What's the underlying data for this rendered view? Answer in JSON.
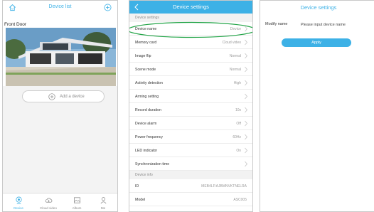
{
  "device_list": {
    "title": "Device list",
    "device": {
      "name": "Front Door"
    },
    "add_device_label": "Add a device",
    "tabs": [
      {
        "label": "Device",
        "icon": "camera-icon",
        "active": true
      },
      {
        "label": "Cloud video",
        "icon": "cloud-icon",
        "active": false
      },
      {
        "label": "Album",
        "icon": "album-icon",
        "active": false
      },
      {
        "label": "Me",
        "icon": "user-icon",
        "active": false
      }
    ]
  },
  "device_settings": {
    "title": "Device settings",
    "section_settings": "Device settings",
    "rows": [
      {
        "label": "Device name",
        "value": "Device"
      },
      {
        "label": "Memory card",
        "value": "Cloud video"
      },
      {
        "label": "Image flip",
        "value": "Normal"
      },
      {
        "label": "Scene mode",
        "value": "Normal"
      },
      {
        "label": "Activity detection",
        "value": "High"
      },
      {
        "label": "Arming setting",
        "value": ""
      },
      {
        "label": "Record duration",
        "value": "10s"
      },
      {
        "label": "Device alarm",
        "value": "Off"
      },
      {
        "label": "Power frequency",
        "value": "60Hz"
      },
      {
        "label": "LED indicator",
        "value": "On"
      },
      {
        "label": "Synchronization time",
        "value": ""
      }
    ],
    "section_info": "Device info",
    "info_rows": [
      {
        "label": "ID",
        "value": "MEB4LP.AJBMNVKTNELRA"
      },
      {
        "label": "Model",
        "value": "ASC005"
      }
    ]
  },
  "modify_name": {
    "title": "Device settings",
    "label": "Modify name",
    "placeholder": "Please input device name",
    "apply_label": "Apply"
  },
  "colors": {
    "accent": "#3db1e6",
    "highlight_ring": "#22a447",
    "section_bg": "#f2f2f2"
  }
}
